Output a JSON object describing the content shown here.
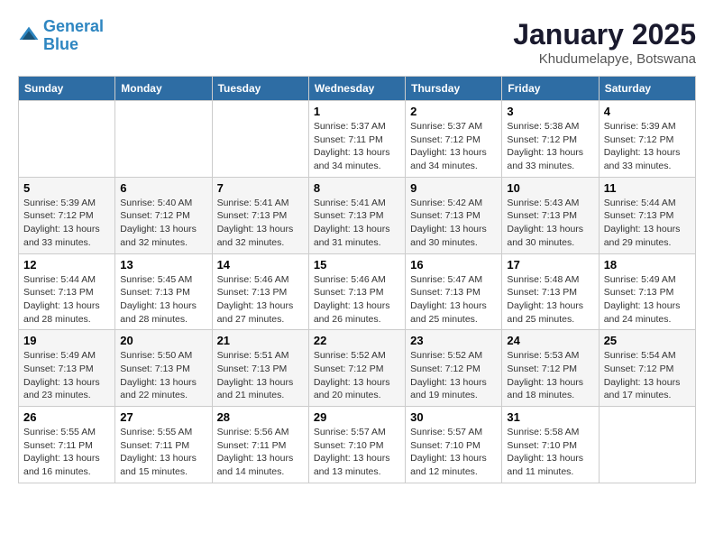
{
  "header": {
    "logo_line1": "General",
    "logo_line2": "Blue",
    "month_title": "January 2025",
    "location": "Khudumelapye, Botswana"
  },
  "weekdays": [
    "Sunday",
    "Monday",
    "Tuesday",
    "Wednesday",
    "Thursday",
    "Friday",
    "Saturday"
  ],
  "weeks": [
    [
      {
        "day": "",
        "sunrise": "",
        "sunset": "",
        "daylight": ""
      },
      {
        "day": "",
        "sunrise": "",
        "sunset": "",
        "daylight": ""
      },
      {
        "day": "",
        "sunrise": "",
        "sunset": "",
        "daylight": ""
      },
      {
        "day": "1",
        "sunrise": "Sunrise: 5:37 AM",
        "sunset": "Sunset: 7:11 PM",
        "daylight": "Daylight: 13 hours and 34 minutes."
      },
      {
        "day": "2",
        "sunrise": "Sunrise: 5:37 AM",
        "sunset": "Sunset: 7:12 PM",
        "daylight": "Daylight: 13 hours and 34 minutes."
      },
      {
        "day": "3",
        "sunrise": "Sunrise: 5:38 AM",
        "sunset": "Sunset: 7:12 PM",
        "daylight": "Daylight: 13 hours and 33 minutes."
      },
      {
        "day": "4",
        "sunrise": "Sunrise: 5:39 AM",
        "sunset": "Sunset: 7:12 PM",
        "daylight": "Daylight: 13 hours and 33 minutes."
      }
    ],
    [
      {
        "day": "5",
        "sunrise": "Sunrise: 5:39 AM",
        "sunset": "Sunset: 7:12 PM",
        "daylight": "Daylight: 13 hours and 33 minutes."
      },
      {
        "day": "6",
        "sunrise": "Sunrise: 5:40 AM",
        "sunset": "Sunset: 7:12 PM",
        "daylight": "Daylight: 13 hours and 32 minutes."
      },
      {
        "day": "7",
        "sunrise": "Sunrise: 5:41 AM",
        "sunset": "Sunset: 7:13 PM",
        "daylight": "Daylight: 13 hours and 32 minutes."
      },
      {
        "day": "8",
        "sunrise": "Sunrise: 5:41 AM",
        "sunset": "Sunset: 7:13 PM",
        "daylight": "Daylight: 13 hours and 31 minutes."
      },
      {
        "day": "9",
        "sunrise": "Sunrise: 5:42 AM",
        "sunset": "Sunset: 7:13 PM",
        "daylight": "Daylight: 13 hours and 30 minutes."
      },
      {
        "day": "10",
        "sunrise": "Sunrise: 5:43 AM",
        "sunset": "Sunset: 7:13 PM",
        "daylight": "Daylight: 13 hours and 30 minutes."
      },
      {
        "day": "11",
        "sunrise": "Sunrise: 5:44 AM",
        "sunset": "Sunset: 7:13 PM",
        "daylight": "Daylight: 13 hours and 29 minutes."
      }
    ],
    [
      {
        "day": "12",
        "sunrise": "Sunrise: 5:44 AM",
        "sunset": "Sunset: 7:13 PM",
        "daylight": "Daylight: 13 hours and 28 minutes."
      },
      {
        "day": "13",
        "sunrise": "Sunrise: 5:45 AM",
        "sunset": "Sunset: 7:13 PM",
        "daylight": "Daylight: 13 hours and 28 minutes."
      },
      {
        "day": "14",
        "sunrise": "Sunrise: 5:46 AM",
        "sunset": "Sunset: 7:13 PM",
        "daylight": "Daylight: 13 hours and 27 minutes."
      },
      {
        "day": "15",
        "sunrise": "Sunrise: 5:46 AM",
        "sunset": "Sunset: 7:13 PM",
        "daylight": "Daylight: 13 hours and 26 minutes."
      },
      {
        "day": "16",
        "sunrise": "Sunrise: 5:47 AM",
        "sunset": "Sunset: 7:13 PM",
        "daylight": "Daylight: 13 hours and 25 minutes."
      },
      {
        "day": "17",
        "sunrise": "Sunrise: 5:48 AM",
        "sunset": "Sunset: 7:13 PM",
        "daylight": "Daylight: 13 hours and 25 minutes."
      },
      {
        "day": "18",
        "sunrise": "Sunrise: 5:49 AM",
        "sunset": "Sunset: 7:13 PM",
        "daylight": "Daylight: 13 hours and 24 minutes."
      }
    ],
    [
      {
        "day": "19",
        "sunrise": "Sunrise: 5:49 AM",
        "sunset": "Sunset: 7:13 PM",
        "daylight": "Daylight: 13 hours and 23 minutes."
      },
      {
        "day": "20",
        "sunrise": "Sunrise: 5:50 AM",
        "sunset": "Sunset: 7:13 PM",
        "daylight": "Daylight: 13 hours and 22 minutes."
      },
      {
        "day": "21",
        "sunrise": "Sunrise: 5:51 AM",
        "sunset": "Sunset: 7:13 PM",
        "daylight": "Daylight: 13 hours and 21 minutes."
      },
      {
        "day": "22",
        "sunrise": "Sunrise: 5:52 AM",
        "sunset": "Sunset: 7:12 PM",
        "daylight": "Daylight: 13 hours and 20 minutes."
      },
      {
        "day": "23",
        "sunrise": "Sunrise: 5:52 AM",
        "sunset": "Sunset: 7:12 PM",
        "daylight": "Daylight: 13 hours and 19 minutes."
      },
      {
        "day": "24",
        "sunrise": "Sunrise: 5:53 AM",
        "sunset": "Sunset: 7:12 PM",
        "daylight": "Daylight: 13 hours and 18 minutes."
      },
      {
        "day": "25",
        "sunrise": "Sunrise: 5:54 AM",
        "sunset": "Sunset: 7:12 PM",
        "daylight": "Daylight: 13 hours and 17 minutes."
      }
    ],
    [
      {
        "day": "26",
        "sunrise": "Sunrise: 5:55 AM",
        "sunset": "Sunset: 7:11 PM",
        "daylight": "Daylight: 13 hours and 16 minutes."
      },
      {
        "day": "27",
        "sunrise": "Sunrise: 5:55 AM",
        "sunset": "Sunset: 7:11 PM",
        "daylight": "Daylight: 13 hours and 15 minutes."
      },
      {
        "day": "28",
        "sunrise": "Sunrise: 5:56 AM",
        "sunset": "Sunset: 7:11 PM",
        "daylight": "Daylight: 13 hours and 14 minutes."
      },
      {
        "day": "29",
        "sunrise": "Sunrise: 5:57 AM",
        "sunset": "Sunset: 7:10 PM",
        "daylight": "Daylight: 13 hours and 13 minutes."
      },
      {
        "day": "30",
        "sunrise": "Sunrise: 5:57 AM",
        "sunset": "Sunset: 7:10 PM",
        "daylight": "Daylight: 13 hours and 12 minutes."
      },
      {
        "day": "31",
        "sunrise": "Sunrise: 5:58 AM",
        "sunset": "Sunset: 7:10 PM",
        "daylight": "Daylight: 13 hours and 11 minutes."
      },
      {
        "day": "",
        "sunrise": "",
        "sunset": "",
        "daylight": ""
      }
    ]
  ]
}
